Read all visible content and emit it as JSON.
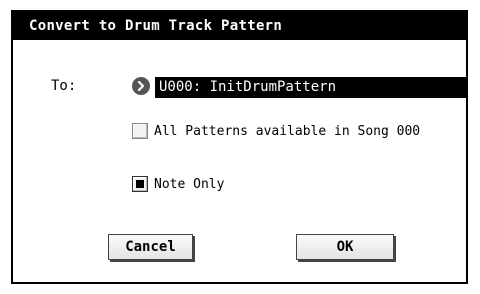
{
  "dialog": {
    "title": "Convert to Drum Track Pattern",
    "to_label": "To:",
    "destination_value": "U000: InitDrumPattern",
    "options": [
      {
        "label": "All Patterns available in Song 000",
        "checked": false
      },
      {
        "label": "Note Only",
        "checked": true
      }
    ],
    "buttons": {
      "cancel": "Cancel",
      "ok": "OK"
    }
  }
}
